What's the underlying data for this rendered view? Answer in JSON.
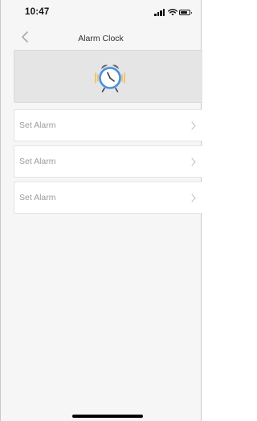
{
  "status_bar": {
    "time": "10:47",
    "icons": [
      "cellular-signal-icon",
      "wifi-icon",
      "battery-icon"
    ]
  },
  "nav": {
    "title": "Alarm Clock",
    "back_icon": "chevron-left-icon"
  },
  "hero": {
    "illustration": "alarm-clock-icon",
    "colors": {
      "clock_ring": "#4a8fe7",
      "ringing_lines": "#f2b437",
      "bells": "#6b6b6b"
    }
  },
  "alarm_rows": [
    {
      "label": "Set Alarm",
      "icon": "chevron-right-icon"
    },
    {
      "label": "Set Alarm",
      "icon": "chevron-right-icon"
    },
    {
      "label": "Set Alarm",
      "icon": "chevron-right-icon"
    }
  ],
  "colors": {
    "background": "#f6f6f6",
    "row_background": "#ffffff",
    "hero_background": "#e5e5e5",
    "row_text": "#9b9b9b"
  }
}
